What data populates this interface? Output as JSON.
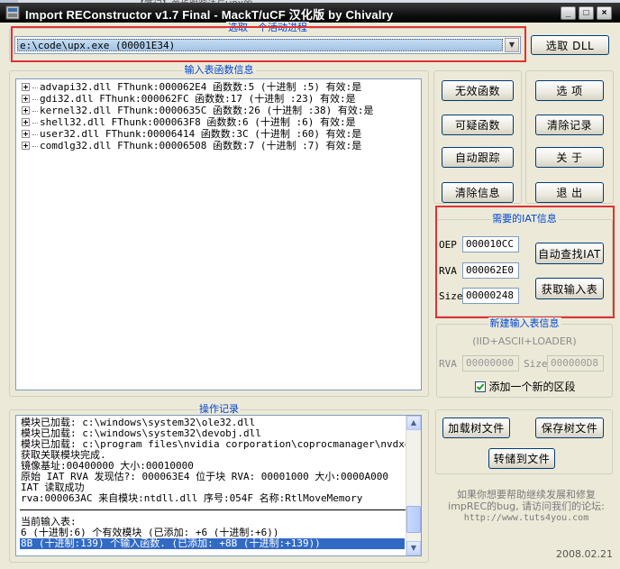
{
  "background": {
    "title_text": "【笔记】单步跟踪法与UPX的……"
  },
  "window": {
    "title": "Import REConstructor v1.7 Final - MackT/uCF 汉化版 by Chivalry",
    "controls": {
      "minimize": "_",
      "maximize": "□",
      "close": "×"
    }
  },
  "process": {
    "legend": "选取一个活动进程",
    "selected": "e:\\code\\upx.exe (00001E34)",
    "pick_dll_label": "选取 DLL"
  },
  "imports": {
    "legend": "输入表函数信息",
    "items": [
      "advapi32.dll FThunk:000062E4 函数数:5 (十进制 :5) 有效:是",
      "gdi32.dll FThunk:000062FC 函数数:17 (十进制 :23) 有效:是",
      "kernel32.dll FThunk:0000635C 函数数:26 (十进制 :38) 有效:是",
      "shell32.dll FThunk:000063F8 函数数:6 (十进制 :6) 有效:是",
      "user32.dll FThunk:00006414 函数数:3C (十进制 :60) 有效:是",
      "comdlg32.dll FThunk:00006508 函数数:7 (十进制 :7) 有效:是"
    ]
  },
  "actions": {
    "invalid_functions": "无效函数",
    "suspect_functions": "可疑函数",
    "auto_trace": "自动跟踪",
    "clear_info": "清除信息",
    "options": "选    项",
    "clear_log": "清除记录",
    "about": "关    于",
    "exit": "退    出"
  },
  "iat": {
    "legend": "需要的IAT信息",
    "oep_label": "OEP",
    "oep_value": "000010CC",
    "rva_label": "RVA",
    "rva_value": "000062E0",
    "size_label": "Size",
    "size_value": "00000248",
    "iat_autosearch": "自动查找IAT",
    "get_imports": "获取输入表"
  },
  "new_import": {
    "legend": "新建输入表信息",
    "subtitle": "(IID+ASCII+LOADER)",
    "rva_label": "RVA",
    "rva_value": "00000000",
    "size_label": "Size",
    "size_value": "000000D8",
    "add_section_label": "添加一个新的区段",
    "add_section_checked": true
  },
  "log": {
    "legend": "操作记录",
    "lines": [
      "模块已加载: c:\\windows\\system32\\ole32.dll",
      "模块已加载: c:\\windows\\system32\\devobj.dll",
      "模块已加载: c:\\program files\\nvidia corporation\\coprocmanager\\nvdxgiwra",
      "获取关联模块完成.",
      "镜像基址:00400000 大小:00010000",
      "原始 IAT RVA 发现估?: 000063E4 位于块 RVA: 00001000 大小:0000A000",
      "IAT 读取成功",
      "rva:000063AC 来自模块:ntdll.dll 序号:054F 名称:RtlMoveMemory"
    ],
    "current_header": "当前输入表:",
    "current_lines": [
      "6 (十进制:6) 个有效模块 (已添加: +6 (十进制:+6))",
      "8B (十进制:139) 个输入函数. (已添加: +8B (十进制:+139))"
    ]
  },
  "tree_file": {
    "load_tree": "加载树文件",
    "save_tree": "保存树文件",
    "fix_dump": "转储到文件"
  },
  "footer": {
    "help_text": "如果你想要帮助继续发展和修复",
    "help_text2": "impREC的bug, 请访问我们的论坛:",
    "url": "http://www.tuts4you.com",
    "date": "2008.02.21"
  }
}
